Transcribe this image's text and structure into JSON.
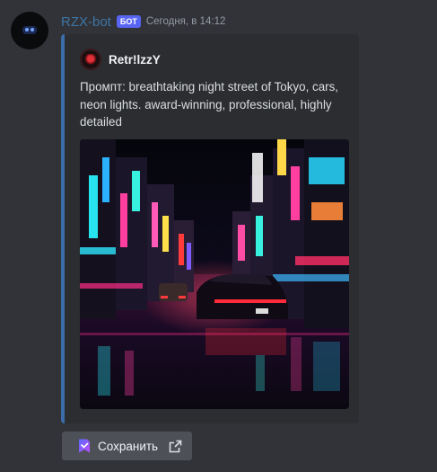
{
  "colors": {
    "background": "#313338",
    "username": "#3e74a4",
    "embed_accent": "#3b6ea8",
    "bot_tag": "#5865f2",
    "button": "#4e5058"
  },
  "message": {
    "username": "RZX-bot",
    "bot_tag": "БОТ",
    "timestamp": "Сегодня, в 14:12",
    "avatar_icon": "robot-avatar-icon"
  },
  "embed": {
    "author": {
      "name": "Retr!lzzY",
      "icon": "author-avatar-icon"
    },
    "description": "Промпт: breathtaking night street of Tokyo, cars, neon lights. award-winning, professional, highly detailed",
    "image_icon": "tokyo-neon-street-image"
  },
  "actions": {
    "save_label": "Сохранить",
    "save_icon": "bookmark-icon",
    "external_icon": "external-link-icon"
  }
}
